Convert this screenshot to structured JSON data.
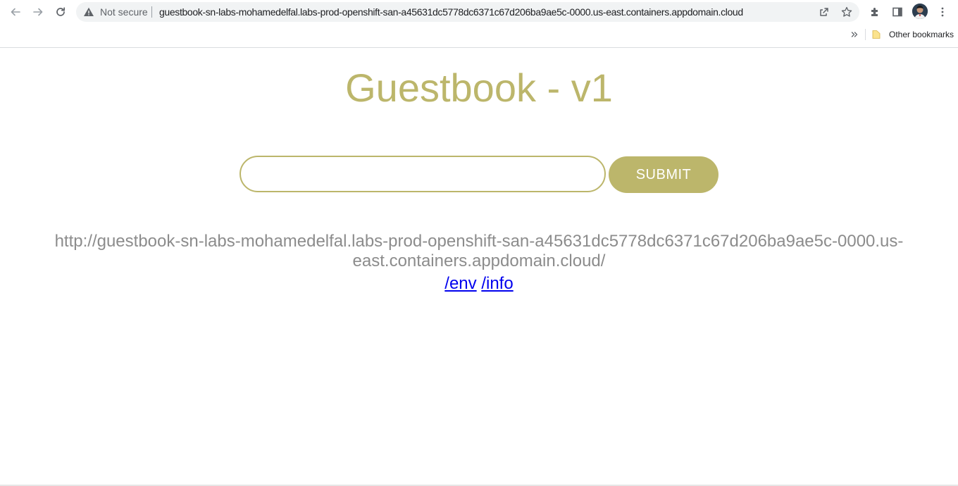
{
  "browser": {
    "security_label": "Not secure",
    "url": "guestbook-sn-labs-mohamedelfal.labs-prod-openshift-san-a45631dc5778dc6371c67d206ba9ae5c-0000.us-east.containers.appdomain.cloud",
    "bookmarks": {
      "other_label": "Other bookmarks"
    },
    "icons": {
      "back": "arrow-left-icon",
      "forward": "arrow-right-icon",
      "reload": "reload-icon",
      "warning": "warning-triangle-icon",
      "share": "share-icon",
      "star": "star-icon",
      "extensions": "puzzle-icon",
      "side_panel": "side-panel-icon",
      "menu": "kebab-menu-icon",
      "folder": "folder-icon"
    }
  },
  "page": {
    "title": "Guestbook - v1",
    "input_value": "",
    "submit_label": "SUBMIT",
    "host_url": "http://guestbook-sn-labs-mohamedelfal.labs-prod-openshift-san-a45631dc5778dc6371c67d206ba9ae5c-0000.us-east.containers.appdomain.cloud/",
    "links": [
      {
        "label": "/env"
      },
      {
        "label": "/info"
      }
    ]
  },
  "colors": {
    "accent": "#bcb66b",
    "host_text": "#8c8c8c",
    "link": "#0000ee"
  }
}
